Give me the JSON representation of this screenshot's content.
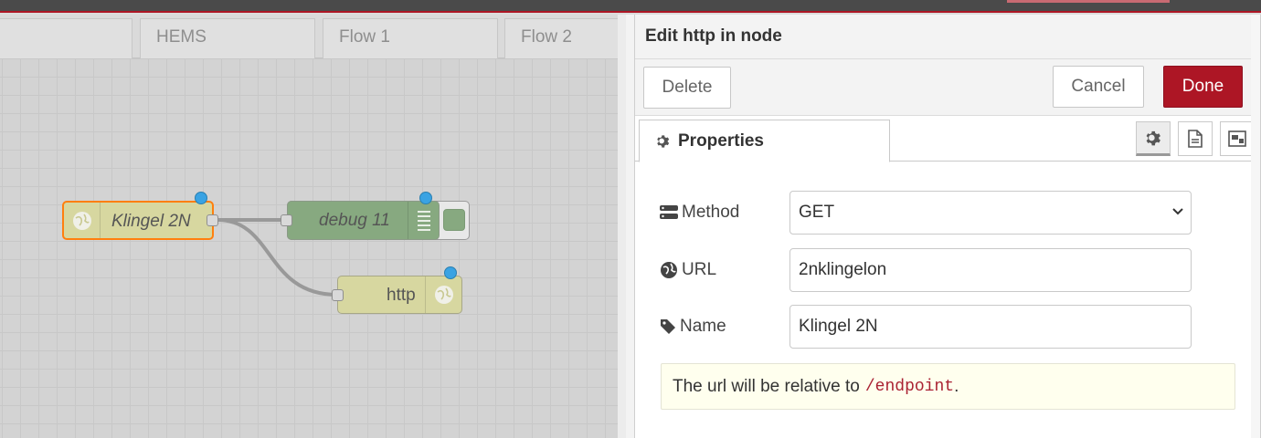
{
  "workspace": {
    "tabs": [
      {
        "label": ""
      },
      {
        "label": "HEMS"
      },
      {
        "label": "Flow 1"
      },
      {
        "label": "Flow 2"
      }
    ],
    "nodes": {
      "klingel": {
        "label": "Klingel 2N",
        "icon": "globe-icon",
        "color": "#d7d7a0",
        "selected": true
      },
      "debug": {
        "label": "debug 11",
        "icon": "list-icon",
        "color": "#87a980"
      },
      "http": {
        "label": "http",
        "icon": "globe-icon",
        "color": "#d7d7a0"
      }
    }
  },
  "tray": {
    "title": "Edit http in node",
    "buttons": {
      "delete": "Delete",
      "cancel": "Cancel",
      "done": "Done"
    },
    "tabs": {
      "properties": "Properties"
    },
    "icon_tabs": [
      "gear-icon",
      "document-icon",
      "appearance-icon"
    ],
    "form": {
      "method": {
        "label": "Method",
        "value": "GET",
        "icon": "method-icon"
      },
      "url": {
        "label": "URL",
        "value": "2nklingelon",
        "icon": "globe-icon"
      },
      "name": {
        "label": "Name",
        "value": "Klingel 2N",
        "icon": "tag-icon"
      }
    },
    "tip": {
      "text": "The url will be relative to",
      "code": "/endpoint",
      "suffix": "."
    },
    "accent_color": "#ad1625"
  }
}
